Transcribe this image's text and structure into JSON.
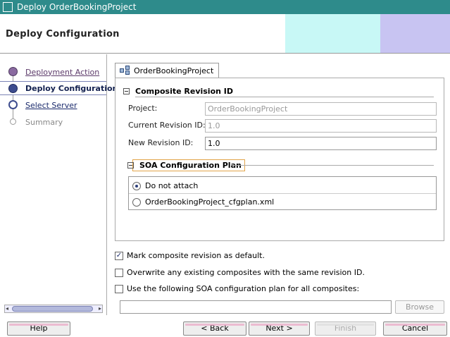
{
  "window": {
    "title": "Deploy OrderBookingProject"
  },
  "header": {
    "title": "Deploy Configuration"
  },
  "nav": {
    "items": [
      {
        "label": "Deployment Action",
        "state": "visited"
      },
      {
        "label": "Deploy Configuration",
        "state": "active"
      },
      {
        "label": "Select Server",
        "state": "link"
      },
      {
        "label": "Summary",
        "state": "disabled"
      }
    ]
  },
  "tab": {
    "label": "OrderBookingProject"
  },
  "composite": {
    "title": "Composite Revision ID",
    "project_label": "Project:",
    "project_value": "OrderBookingProject",
    "current_label": "Current Revision ID:",
    "current_value": "1.0",
    "new_label": "New Revision ID:",
    "new_value": "1.0"
  },
  "soa": {
    "title": "SOA Configuration Plan",
    "options": [
      {
        "label": "Do not attach",
        "selected": true
      },
      {
        "label": "OrderBookingProject_cfgplan.xml",
        "selected": false
      }
    ]
  },
  "checks": [
    {
      "label": "Mark composite revision as default.",
      "checked": true
    },
    {
      "label": "Overwrite any existing composites with the same revision ID.",
      "checked": false
    },
    {
      "label": "Use the following SOA configuration plan for all composites:",
      "checked": false
    }
  ],
  "plan_field": {
    "value": ""
  },
  "browse_label": "Browse",
  "buttons": {
    "help": "Help",
    "back": "< Back",
    "next": "Next >",
    "finish": "Finish",
    "cancel": "Cancel"
  },
  "colors": {
    "titlebar": "#2e8b8b",
    "header_band_cyan": "#c8f8f6",
    "header_band_lavender": "#c8c4f2",
    "nav_link": "#1a2a6c",
    "soa_highlight": "#e2a54a"
  }
}
